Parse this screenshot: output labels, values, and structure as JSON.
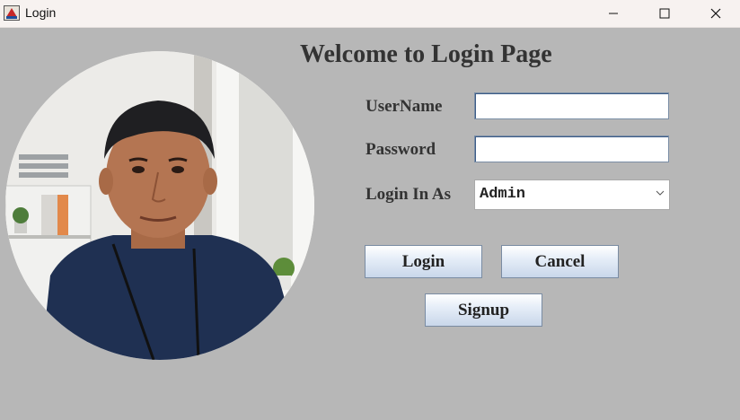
{
  "window": {
    "title": "Login"
  },
  "heading": "Welcome to Login Page",
  "form": {
    "username_label": "UserName",
    "username_value": "",
    "password_label": "Password",
    "password_value": "",
    "role_label": "Login In As",
    "role_selected": "Admin"
  },
  "buttons": {
    "login": "Login",
    "cancel": "Cancel",
    "signup": "Signup"
  },
  "colors": {
    "background": "#b7b7b7",
    "titlebar": "#f7f2f0",
    "button_gradient_end": "#c9d7ea"
  },
  "icons": [
    "app-icon",
    "minimize-icon",
    "maximize-icon",
    "close-icon",
    "chevron-down-icon"
  ]
}
